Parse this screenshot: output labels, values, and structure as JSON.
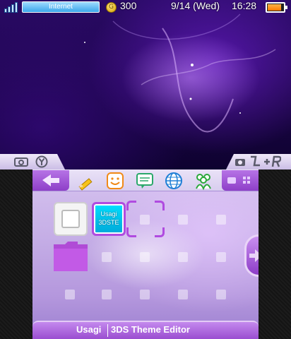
{
  "status_bar": {
    "connection": "Internet",
    "coins": "300",
    "coin_symbol": "G",
    "date": "9/14 (Wed)",
    "time": "16:28",
    "battery_level": 0.85
  },
  "bottom": {
    "selected_app": {
      "title": "Usagi",
      "subtitle": "3DS Theme Editor"
    },
    "tiles": [
      {
        "name": "game-card-slot",
        "label": ""
      },
      {
        "name": "usagi-tile",
        "label_line1": "Usagi",
        "label_line2": "3DSTE"
      }
    ]
  },
  "colors": {
    "accent": "#a64fdc",
    "network_pill": "#3aa6ea",
    "panel": "#c5aee6"
  },
  "icons": {
    "toolbar": [
      "back-icon",
      "pencil-icon",
      "smile-icon",
      "chat-icon",
      "globe-icon",
      "friends-icon",
      "grid-view-icon"
    ],
    "shoulders": [
      "camera-icon",
      "y-button-icon",
      "camera-icon",
      "l-r-buttons-icon"
    ]
  }
}
